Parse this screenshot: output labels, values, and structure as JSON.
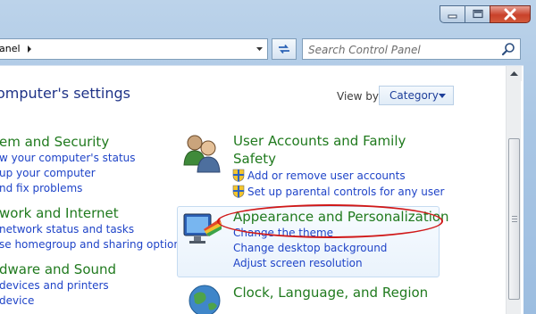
{
  "window": {
    "min_icon": "minimize-icon",
    "max_icon": "maximize-icon",
    "close_icon": "close-icon"
  },
  "address": {
    "crumb": "anel"
  },
  "search": {
    "placeholder": "Search Control Panel"
  },
  "main": {
    "title": "omputer's settings",
    "view_by_label": "View by:",
    "view_by_value": "Category"
  },
  "left": [
    {
      "heading": "em and Security",
      "links": [
        "w your computer's status",
        "up your computer",
        "nd fix problems"
      ]
    },
    {
      "heading": "work and Internet",
      "links": [
        "network status and tasks",
        "se homegroup and sharing options"
      ]
    },
    {
      "heading": "dware and Sound",
      "links": [
        "devices and printers",
        "device"
      ]
    }
  ],
  "right": [
    {
      "heading": "User Accounts and Family Safety",
      "heading_line1": "User Accounts and Family",
      "heading_line2": "Safety",
      "links": [
        "Add or remove user accounts",
        "Set up parental controls for any user"
      ],
      "icon": "user-accounts-icon"
    },
    {
      "heading": "Appearance and Personalization",
      "links": [
        "Change the theme",
        "Change desktop background",
        "Adjust screen resolution"
      ],
      "icon": "appearance-icon"
    },
    {
      "heading": "Clock, Language, and Region",
      "links": [],
      "icon": "clock-globe-icon"
    }
  ],
  "colors": {
    "heading": "#207a1e",
    "link": "#1f44c8",
    "title": "#1e3287",
    "annotation": "#d01818"
  }
}
